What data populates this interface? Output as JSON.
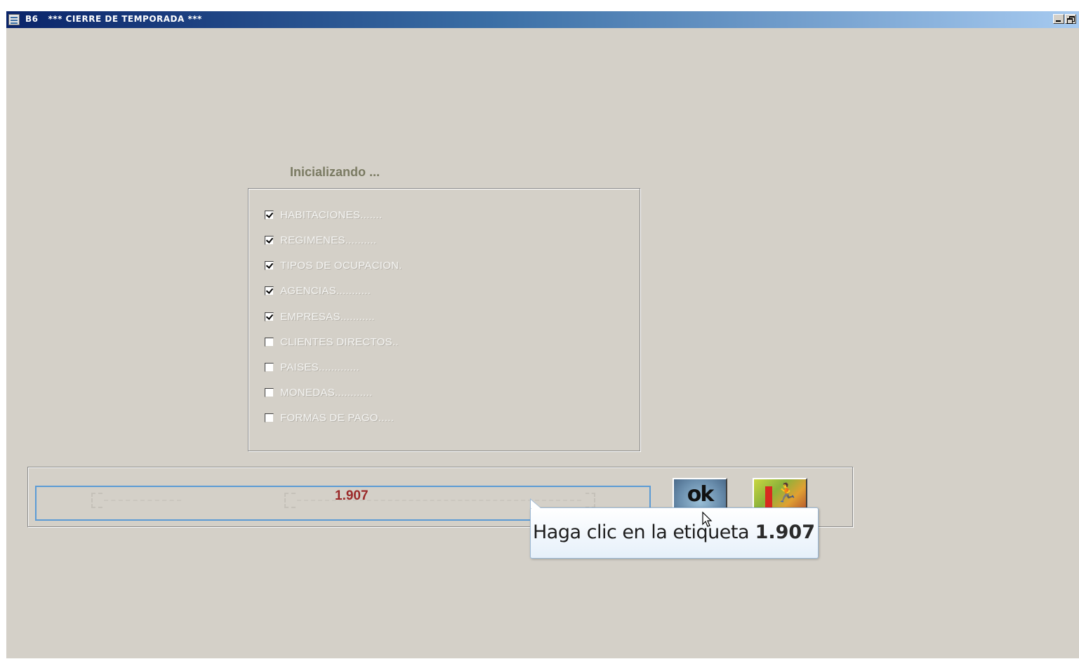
{
  "window": {
    "title": "B6   *** CIERRE DE TEMPORADA ***",
    "icons": {
      "app": "app-icon",
      "minimize": "minimize-icon",
      "restore": "restore-icon"
    }
  },
  "section": {
    "heading": "Inicializando ..."
  },
  "items": [
    {
      "label": "HABITACIONES.......",
      "checked": true
    },
    {
      "label": "REGIMENES..........",
      "checked": true
    },
    {
      "label": "TIPOS DE OCUPACION.",
      "checked": true
    },
    {
      "label": "AGENCIAS...........",
      "checked": true
    },
    {
      "label": "EMPRESAS...........",
      "checked": true
    },
    {
      "label": "CLIENTES DIRECTOS..",
      "checked": false
    },
    {
      "label": "PAISES.............",
      "checked": false
    },
    {
      "label": "MONEDAS............",
      "checked": false
    },
    {
      "label": "FORMAS DE PAGO.....",
      "checked": false
    }
  ],
  "progress": {
    "value": "1.907"
  },
  "buttons": {
    "ok": {
      "label": "ok",
      "icon": "ok-icon"
    },
    "exit": {
      "icon": "exit-door-icon"
    }
  },
  "tooltip": {
    "text": "Haga clic en la etiqueta",
    "value": "1.907"
  },
  "colors": {
    "titlebar_start": "#0a246a",
    "titlebar_end": "#a6caf0",
    "progress_value": "#9b2a2a",
    "tooltip_border": "#9ab8d6"
  }
}
